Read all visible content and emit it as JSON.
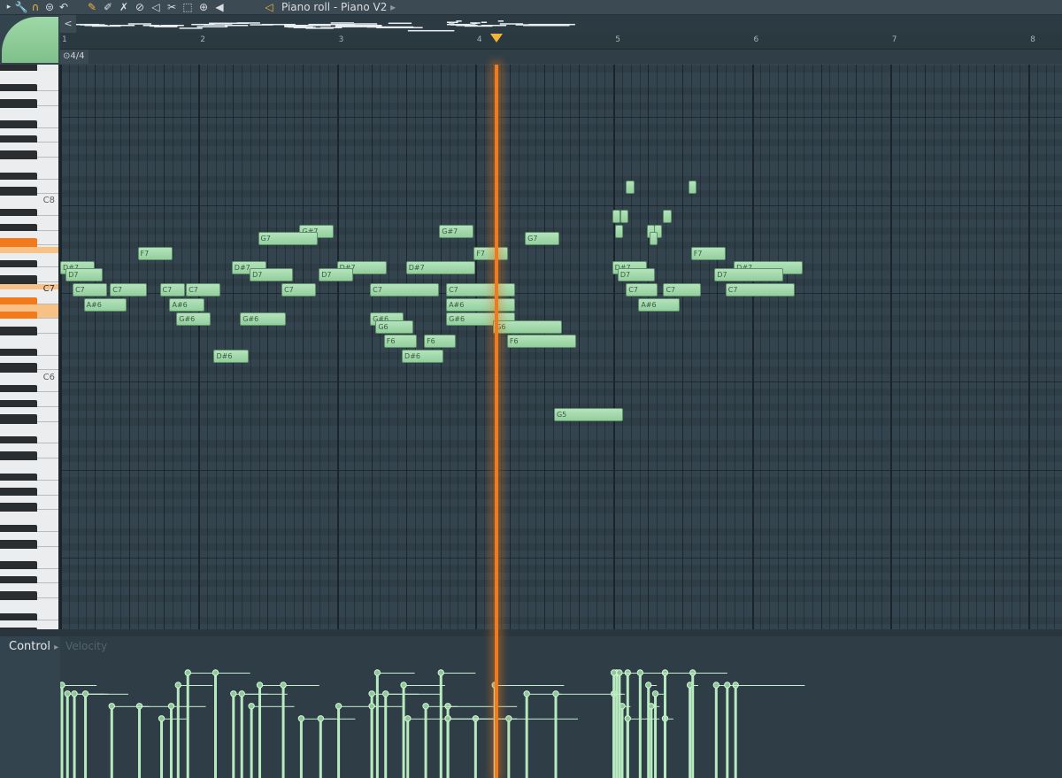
{
  "window": {
    "title": "Piano roll - Piano V2",
    "title_arrow": "▸"
  },
  "toolbar": {
    "icons": [
      "menu-arrow-icon",
      "wrench-icon",
      "magnet-icon",
      "menu-icon",
      "undo-icon",
      "pencil-icon",
      "paint-icon",
      "delete-icon",
      "mute-icon",
      "slip-icon",
      "slice-icon",
      "select-icon",
      "zoom-icon",
      "playback-icon",
      "speaker-icon"
    ]
  },
  "ruler": {
    "bars": [
      "1",
      "2",
      "3",
      "4",
      "5",
      "6",
      "7",
      "8"
    ],
    "time_signature": "4/4",
    "overview_arrow": "<"
  },
  "keyboard": {
    "labels": [
      {
        "note": "C8"
      },
      {
        "note": "C7"
      },
      {
        "note": "C6"
      }
    ]
  },
  "notes": [
    {
      "label": "",
      "pitch": "C8+",
      "start": 5.09,
      "len": 0.06
    },
    {
      "label": "",
      "pitch": "C8+",
      "start": 5.54,
      "len": 0.06
    },
    {
      "label": "",
      "pitch": "A#7",
      "start": 4.99,
      "len": 0.06
    },
    {
      "label": "",
      "pitch": "A#7",
      "start": 5.05,
      "len": 0.06
    },
    {
      "label": "",
      "pitch": "A#7",
      "start": 5.36,
      "len": 0.06
    },
    {
      "label": "",
      "pitch": "G#7",
      "start": 5.01,
      "len": 0.06
    },
    {
      "label": "",
      "pitch": "G#7",
      "start": 5.24,
      "len": 0.06
    },
    {
      "label": "",
      "pitch": "G#7",
      "start": 5.29,
      "len": 0.06
    },
    {
      "label": "",
      "pitch": "G7",
      "start": 5.26,
      "len": 0.06
    },
    {
      "label": "G#7",
      "pitch": "G#7",
      "start": 2.73,
      "len": 0.25
    },
    {
      "label": "G#7",
      "pitch": "G#7",
      "start": 3.74,
      "len": 0.25
    },
    {
      "label": "G7",
      "pitch": "G7",
      "start": 2.43,
      "len": 0.43
    },
    {
      "label": "G7",
      "pitch": "G7",
      "start": 4.36,
      "len": 0.25
    },
    {
      "label": "F7",
      "pitch": "F7",
      "start": 1.56,
      "len": 0.25
    },
    {
      "label": "F7",
      "pitch": "F7",
      "start": 3.99,
      "len": 0.25
    },
    {
      "label": "F7",
      "pitch": "F7",
      "start": 5.56,
      "len": 0.25
    },
    {
      "label": "D#7",
      "pitch": "D#7",
      "start": 1.0,
      "len": 0.25
    },
    {
      "label": "D#7",
      "pitch": "D#7",
      "start": 2.24,
      "len": 0.25
    },
    {
      "label": "D#7",
      "pitch": "D#7",
      "start": 3.0,
      "len": 0.36
    },
    {
      "label": "D#7",
      "pitch": "D#7",
      "start": 3.5,
      "len": 0.5
    },
    {
      "label": "D#7",
      "pitch": "D#7",
      "start": 4.99,
      "len": 0.25
    },
    {
      "label": "D#7",
      "pitch": "D#7",
      "start": 5.87,
      "len": 0.5
    },
    {
      "label": "D7",
      "pitch": "D7",
      "start": 1.04,
      "len": 0.27
    },
    {
      "label": "D7",
      "pitch": "D7",
      "start": 2.37,
      "len": 0.31
    },
    {
      "label": "D7",
      "pitch": "D7",
      "start": 2.87,
      "len": 0.25
    },
    {
      "label": "D7",
      "pitch": "D7",
      "start": 5.03,
      "len": 0.27
    },
    {
      "label": "D7",
      "pitch": "D7",
      "start": 5.73,
      "len": 0.5
    },
    {
      "label": "C7",
      "pitch": "C7",
      "start": 1.09,
      "len": 0.25
    },
    {
      "label": "C7",
      "pitch": "C7",
      "start": 1.36,
      "len": 0.27
    },
    {
      "label": "C7",
      "pitch": "C7",
      "start": 1.72,
      "len": 0.18
    },
    {
      "label": "C7",
      "pitch": "C7",
      "start": 1.91,
      "len": 0.25
    },
    {
      "label": "C7",
      "pitch": "C7",
      "start": 2.6,
      "len": 0.25
    },
    {
      "label": "C7",
      "pitch": "C7",
      "start": 3.24,
      "len": 0.5
    },
    {
      "label": "C7",
      "pitch": "C7",
      "start": 3.79,
      "len": 0.5
    },
    {
      "label": "C7",
      "pitch": "C7",
      "start": 5.09,
      "len": 0.23
    },
    {
      "label": "C7",
      "pitch": "C7",
      "start": 5.36,
      "len": 0.27
    },
    {
      "label": "C7",
      "pitch": "C7",
      "start": 5.81,
      "len": 0.5
    },
    {
      "label": "A#6",
      "pitch": "A#6",
      "start": 1.17,
      "len": 0.31
    },
    {
      "label": "A#6",
      "pitch": "A#6",
      "start": 1.79,
      "len": 0.25
    },
    {
      "label": "A#6",
      "pitch": "A#6",
      "start": 3.79,
      "len": 0.5
    },
    {
      "label": "A#6",
      "pitch": "A#6",
      "start": 5.18,
      "len": 0.3
    },
    {
      "label": "G#6",
      "pitch": "G#6",
      "start": 1.84,
      "len": 0.25
    },
    {
      "label": "G#6",
      "pitch": "G#6",
      "start": 2.3,
      "len": 0.33
    },
    {
      "label": "G#6",
      "pitch": "G#6",
      "start": 3.24,
      "len": 0.24
    },
    {
      "label": "G#6",
      "pitch": "G#6",
      "start": 3.79,
      "len": 0.5
    },
    {
      "label": "G6",
      "pitch": "G6",
      "start": 3.28,
      "len": 0.27
    },
    {
      "label": "G6",
      "pitch": "G6",
      "start": 4.13,
      "len": 0.5
    },
    {
      "label": "F6",
      "pitch": "F6",
      "start": 3.34,
      "len": 0.24
    },
    {
      "label": "F6",
      "pitch": "F6",
      "start": 3.63,
      "len": 0.23
    },
    {
      "label": "F6",
      "pitch": "F6",
      "start": 4.23,
      "len": 0.5
    },
    {
      "label": "D#6",
      "pitch": "D#6",
      "start": 2.11,
      "len": 0.25
    },
    {
      "label": "D#6",
      "pitch": "D#6",
      "start": 3.47,
      "len": 0.3
    },
    {
      "label": "G5",
      "pitch": "G5",
      "start": 4.57,
      "len": 0.5
    }
  ],
  "playhead_position": 4.15,
  "control": {
    "label": "Control",
    "arrow": "▸",
    "parameter": "Velocity"
  },
  "colors": {
    "note": "#a6dbaf",
    "playhead": "#f07a1c",
    "accent": "#f0b43c",
    "grid": "#34444e"
  }
}
